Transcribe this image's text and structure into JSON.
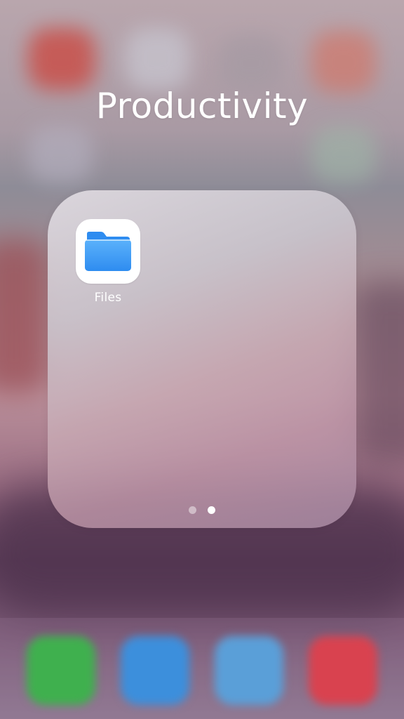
{
  "folder": {
    "title": "Productivity",
    "apps": [
      {
        "label": "Files",
        "icon": "folder-icon"
      }
    ],
    "page_count": 2,
    "current_page": 2
  },
  "dock": {
    "apps": [
      {
        "icon": "phone-icon"
      },
      {
        "icon": "mail-icon"
      },
      {
        "icon": "safari-icon"
      },
      {
        "icon": "music-icon"
      }
    ]
  },
  "colors": {
    "files_blue": "#2e8cf0",
    "files_blue_light": "#5cb2fb",
    "text": "#ffffff"
  }
}
